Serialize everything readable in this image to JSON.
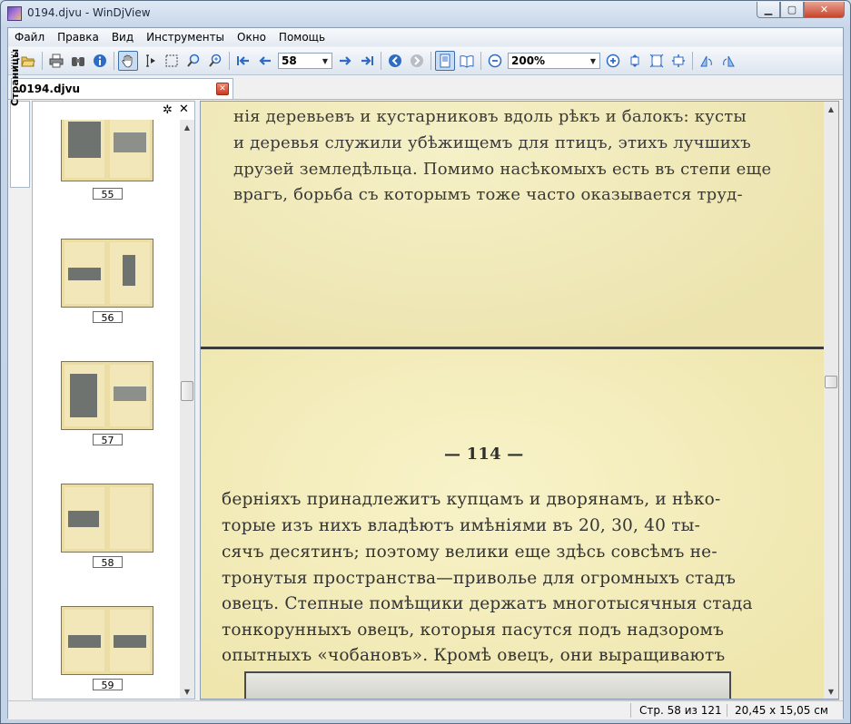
{
  "window": {
    "title": "0194.djvu - WinDjView",
    "min_label": "▁",
    "max_label": "▢",
    "close_label": "✕"
  },
  "menu": [
    "Файл",
    "Правка",
    "Вид",
    "Инструменты",
    "Окно",
    "Помощь"
  ],
  "toolbar": {
    "page_value": "58",
    "zoom_value": "200%"
  },
  "tab": {
    "label": "0194.djvu",
    "close_label": "✕"
  },
  "sidebar": {
    "tab_label": "Страницы",
    "gear_label": "✲",
    "close_label": "✕",
    "thumbnails": [
      "55",
      "56",
      "57",
      "58",
      "59"
    ]
  },
  "document": {
    "page_top_lines": [
      "нія деревьевъ и кустарниковъ вдоль рѣкъ и балокъ: кусты",
      "и деревья служили убѣжищемъ для птицъ, этихъ лучшихъ",
      "друзей земледѣльца. Помимо насѣкомыхъ есть въ степи еще",
      "врагъ, борьба съ которымъ тоже часто оказывается труд-"
    ],
    "page_number": "— 114 —",
    "page_bottom_lines": [
      "берніяхъ принадлежитъ купцамъ и дворянамъ, и нѣко-",
      "торые изъ нихъ владѣютъ имѣніями въ 20, 30, 40 ты-",
      "сячъ десятинъ; поэтому велики еще здѣсь совсѣмъ не-",
      "тронутыя пространства—приволье для огромныхъ стадъ",
      "овецъ. Степные помѣщики держатъ многотысячныя стада",
      "тонкорунныхъ овецъ, которыя пасутся подъ надзоромъ",
      "опытныхъ «чобановъ». Кромѣ овецъ, они выращиваютъ"
    ]
  },
  "status": {
    "page": "Стр. 58 из 121",
    "size": "20,45 x 15,05 см"
  },
  "colors": {
    "page_bg": "#efe6ae",
    "accent": "#3d6fa8",
    "close_red": "#c7442b"
  }
}
